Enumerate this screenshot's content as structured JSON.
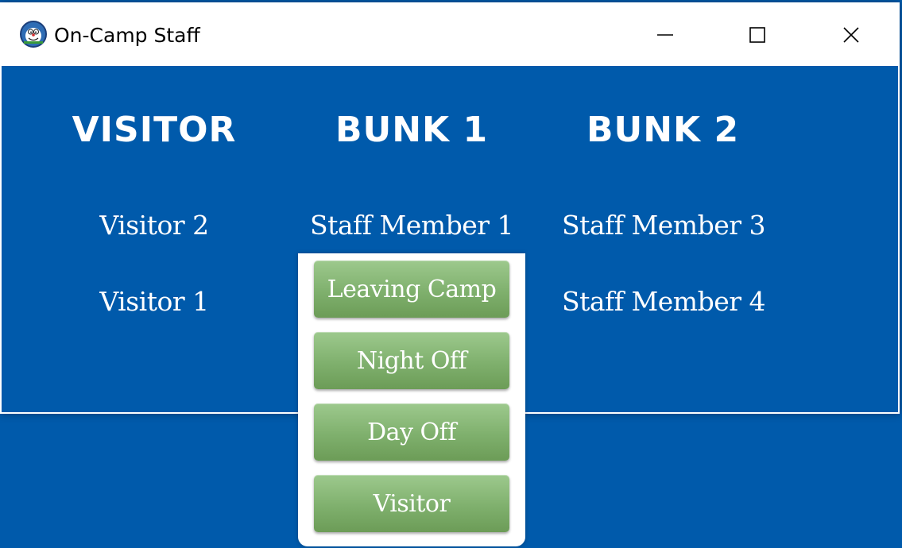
{
  "window": {
    "title": "On-Camp Staff",
    "controls": {
      "minimize_icon": "minimize-icon",
      "maximize_icon": "maximize-icon",
      "close_icon": "close-icon"
    }
  },
  "columns": [
    {
      "header": "VISITOR",
      "items": [
        "Visitor 2",
        "Visitor 1"
      ]
    },
    {
      "header": "BUNK 1",
      "items": [
        "Staff Member 1"
      ]
    },
    {
      "header": "BUNK 2",
      "items": [
        "Staff Member 3",
        "Staff Member 4"
      ]
    }
  ],
  "context_menu": {
    "items": [
      "Leaving Camp",
      "Night Off",
      "Day Off",
      "Visitor"
    ]
  },
  "colors": {
    "background": "#005aab",
    "text": "#ffffff",
    "button_green": "#7fb06d",
    "titlebar": "#ffffff"
  }
}
